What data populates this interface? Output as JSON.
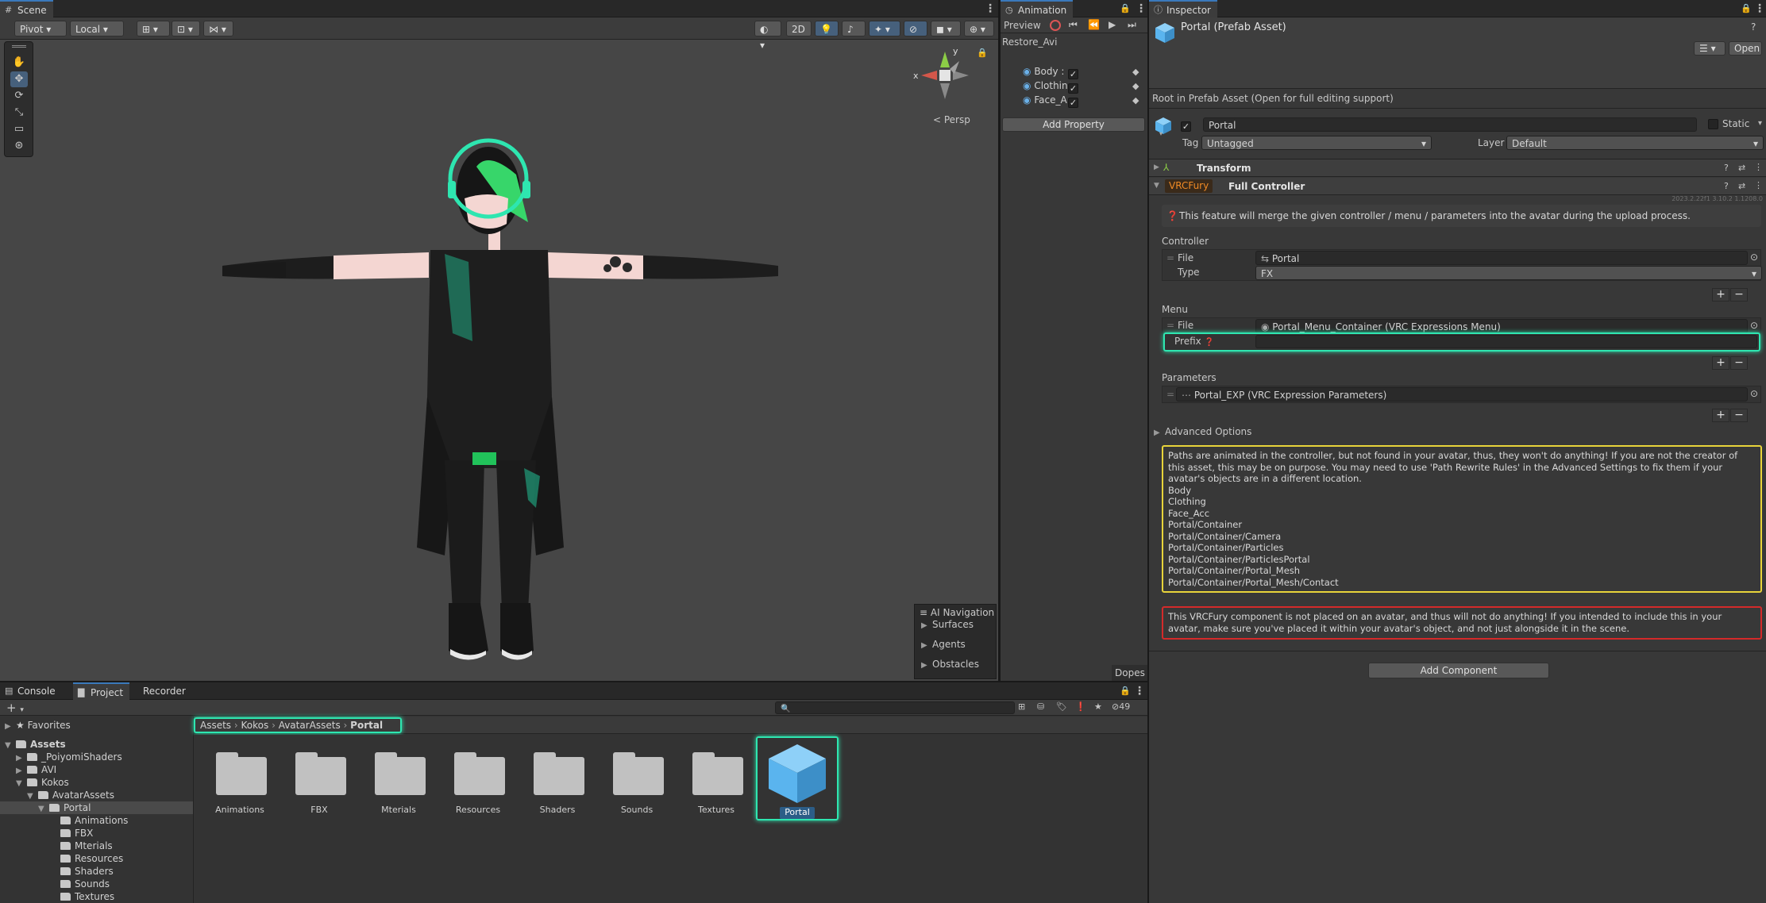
{
  "scene": {
    "tab": "Scene",
    "pivot": "Pivot",
    "local": "Local",
    "mode2d": "2D",
    "persp": "< Persp",
    "gizmo_y": "y",
    "gizmo_x": "x",
    "ai_nav": {
      "title": "AI Navigation",
      "items": [
        "Surfaces",
        "Agents",
        "Obstacles"
      ]
    }
  },
  "animation": {
    "tab": "Animation",
    "preview": "Preview",
    "clip": "Restore_Avi",
    "properties": [
      "Body :",
      "Clothin",
      "Face_A"
    ],
    "add_property": "Add Property",
    "dopesheet": "Dopes"
  },
  "inspector": {
    "tab": "Inspector",
    "title": "Portal (Prefab Asset)",
    "open": "Open",
    "root_note": "Root in Prefab Asset (Open for full editing support)",
    "name": "Portal",
    "static": "Static",
    "tag_label": "Tag",
    "tag_value": "Untagged",
    "layer_label": "Layer",
    "layer_value": "Default",
    "transform": "Transform",
    "vrcfury_badge": "VRCFury",
    "component": "Full Controller",
    "version": "2023.2.22f1 3.10.2 1.1208.0",
    "info": "This feature will merge the given controller / menu / parameters into the avatar during the upload process.",
    "controller_header": "Controller",
    "file_label": "File",
    "controller_file": "Portal",
    "type_label": "Type",
    "type_value": "FX",
    "menu_header": "Menu",
    "menu_file": "Portal_Menu_Container (VRC Expressions Menu)",
    "prefix_label": "Prefix",
    "parameters_header": "Parameters",
    "params_file": "Portal_EXP (VRC Expression Parameters)",
    "advanced": "Advanced Options",
    "warning": "Paths are animated in the controller, but not found in your avatar, thus, they won't do anything! If you are not the creator of this asset, this may be on purpose. You may need to use 'Path Rewrite Rules' in the Advanced Settings to fix them if your avatar's objects are in a different location.",
    "paths": [
      "Body",
      "Clothing",
      "Face_Acc",
      "Portal/Container",
      "Portal/Container/Camera",
      "Portal/Container/Particles",
      "Portal/Container/ParticlesPortal",
      "Portal/Container/Portal_Mesh",
      "Portal/Container/Portal_Mesh/Contact"
    ],
    "error": "This VRCFury component is not placed on an avatar, and thus will not do anything! If you intended to include this in your avatar, make sure you've placed it within your avatar's object, and not just alongside it in the scene.",
    "add_component": "Add Component"
  },
  "project": {
    "tabs": [
      "Console",
      "Project",
      "Recorder"
    ],
    "count": "49",
    "favorites": "Favorites",
    "tree": [
      "Assets",
      "_PoiyomiShaders",
      "AVI",
      "Kokos",
      "AvatarAssets",
      "Portal",
      "Animations",
      "FBX",
      "Mterials",
      "Resources",
      "Shaders",
      "Sounds",
      "Textures"
    ],
    "breadcrumb": [
      "Assets",
      "Kokos",
      "AvatarAssets",
      "Portal"
    ],
    "grid": [
      "Animations",
      "FBX",
      "Mterials",
      "Resources",
      "Shaders",
      "Sounds",
      "Textures",
      "Portal"
    ]
  },
  "colors": {
    "highlight": "#2ee6b0",
    "warning_border": "#e8d43a",
    "error_border": "#d42a2a",
    "prefab_blue": "#5ab4ee",
    "vrcfury_orange": "#f08a24"
  }
}
